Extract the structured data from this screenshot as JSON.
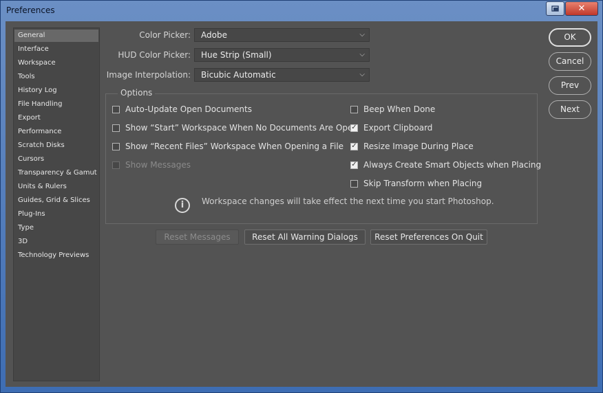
{
  "window": {
    "title": "Preferences",
    "close_glyph": "✕",
    "restore_icon": "restore-icon"
  },
  "sidebar": {
    "items": [
      {
        "label": "General",
        "active": true
      },
      {
        "label": "Interface"
      },
      {
        "label": "Workspace"
      },
      {
        "label": "Tools"
      },
      {
        "label": "History Log"
      },
      {
        "label": "File Handling"
      },
      {
        "label": "Export"
      },
      {
        "label": "Performance"
      },
      {
        "label": "Scratch Disks"
      },
      {
        "label": "Cursors"
      },
      {
        "label": "Transparency & Gamut"
      },
      {
        "label": "Units & Rulers"
      },
      {
        "label": "Guides, Grid & Slices"
      },
      {
        "label": "Plug-Ins"
      },
      {
        "label": "Type"
      },
      {
        "label": "3D"
      },
      {
        "label": "Technology Previews"
      }
    ]
  },
  "fields": {
    "color_picker": {
      "label": "Color Picker:",
      "value": "Adobe"
    },
    "hud_color_picker": {
      "label": "HUD Color Picker:",
      "value": "Hue Strip (Small)"
    },
    "image_interpolation": {
      "label": "Image Interpolation:",
      "value": "Bicubic Automatic"
    }
  },
  "options": {
    "title": "Options",
    "left": [
      {
        "label": "Auto-Update Open Documents",
        "checked": false
      },
      {
        "label": "Show “Start” Workspace When No Documents Are Open",
        "checked": false
      },
      {
        "label": "Show “Recent Files” Workspace When Opening a File",
        "checked": false
      },
      {
        "label": "Show Messages",
        "checked": false,
        "disabled": true
      }
    ],
    "right": [
      {
        "label": "Beep When Done",
        "checked": false
      },
      {
        "label": "Export Clipboard",
        "checked": true
      },
      {
        "label": "Resize Image During Place",
        "checked": true
      },
      {
        "label": "Always Create Smart Objects when Placing",
        "checked": true
      },
      {
        "label": "Skip Transform when Placing",
        "checked": false
      }
    ],
    "info": "Workspace changes will take effect the next time you start Photoshop.",
    "check_glyph": "✓"
  },
  "buttons": {
    "reset_messages": "Reset Messages",
    "reset_warnings": "Reset All Warning Dialogs",
    "reset_prefs": "Reset Preferences On Quit",
    "ok": "OK",
    "cancel": "Cancel",
    "prev": "Prev",
    "next": "Next"
  },
  "colors": {
    "panel_bg": "#535353",
    "titlebar": "#3e6db3",
    "close_button": "#c0382a"
  }
}
